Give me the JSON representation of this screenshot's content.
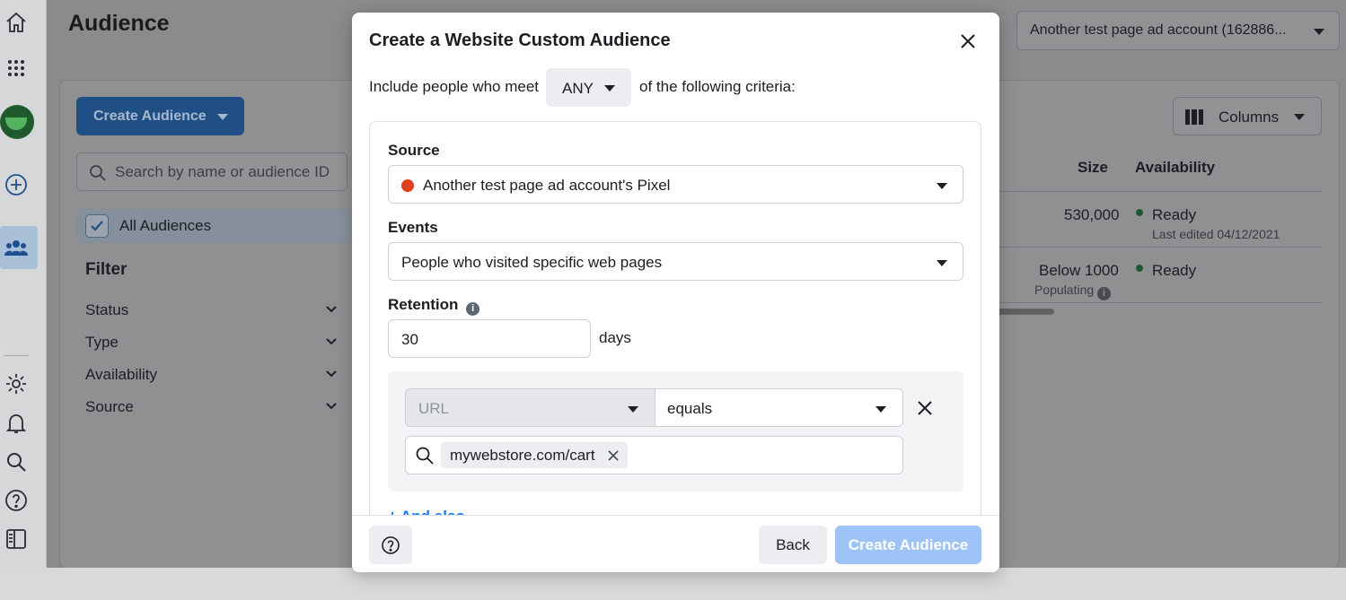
{
  "colors": {
    "accent": "#1877f2",
    "primary_button": "#1877f2",
    "disabled_button": "#9dc3f8",
    "source_dot": "#e0401f",
    "ready_dot": "#1d5b35"
  },
  "rail": {
    "icons": [
      "home-icon",
      "apps-grid-icon",
      "avatar",
      "add-circle-icon",
      "audience-people-icon",
      "settings-gear-icon",
      "notifications-bell-icon",
      "search-icon",
      "help-icon",
      "reports-panel-icon"
    ]
  },
  "header": {
    "title": "Audience",
    "account_select": "Another test page ad account (162886..."
  },
  "sidebar": {
    "create_button": "Create Audience",
    "search_placeholder": "Search by name or audience ID",
    "all_audiences": "All Audiences",
    "filter_title": "Filter",
    "filters": [
      {
        "label": "Status"
      },
      {
        "label": "Type"
      },
      {
        "label": "Availability"
      },
      {
        "label": "Source"
      }
    ]
  },
  "table": {
    "columns_button": "Columns",
    "headers": {
      "size": "Size",
      "availability": "Availability"
    },
    "rows": [
      {
        "size": "530,000",
        "size_note": "",
        "availability": "Ready",
        "availability_note": "Last edited 04/12/2021"
      },
      {
        "size": "Below 1000",
        "size_note": "Populating",
        "availability": "Ready",
        "availability_note": ""
      }
    ]
  },
  "modal": {
    "title": "Create a Website Custom Audience",
    "include_prefix": "Include people who meet",
    "match_value": "ANY",
    "include_suffix": "of the following criteria:",
    "source_label": "Source",
    "source_value": "Another test page ad account's Pixel",
    "events_label": "Events",
    "events_value": "People who visited specific web pages",
    "retention_label": "Retention",
    "retention_value": "30",
    "retention_unit": "days",
    "rule": {
      "field": "URL",
      "operator": "equals",
      "token": "mywebstore.com/cart"
    },
    "and_also": "+ And also",
    "footer": {
      "back": "Back",
      "create": "Create Audience"
    }
  }
}
